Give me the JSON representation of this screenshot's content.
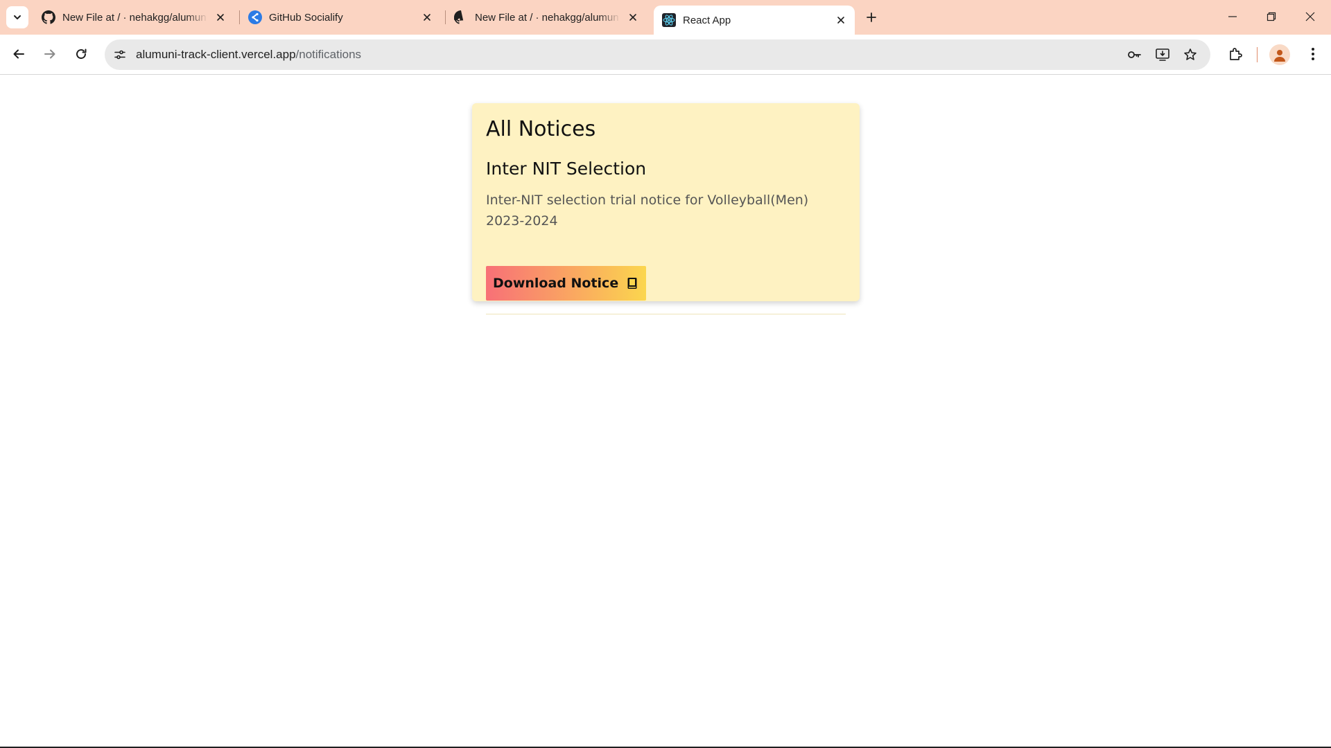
{
  "browser": {
    "tabs": [
      {
        "title": "New File at / · nehakgg/alumun",
        "favicon": "github-icon"
      },
      {
        "title": "GitHub Socialify",
        "favicon": "socialify-icon"
      },
      {
        "title": "New File at / · nehakgg/alumun",
        "favicon": "github-icon"
      },
      {
        "title": "React App",
        "favicon": "react-icon",
        "active": true
      }
    ],
    "address": {
      "host": "alumuni-track-client.vercel.app",
      "path": "/notifications"
    },
    "colors": {
      "tabstrip": "#fbd4c2",
      "omnibox": "#e9e9e9"
    }
  },
  "page": {
    "heading": "All Notices",
    "notices": [
      {
        "title": "Inter NIT Selection",
        "description": "Inter-NIT selection trial notice for Volleyball(Men) 2023-2024",
        "button_label": "Download Notice",
        "button_icon": "book-icon"
      }
    ],
    "colors": {
      "card_background": "#fef2c2",
      "button_gradient_start": "#f87077",
      "button_gradient_end": "#fbd64e"
    }
  }
}
